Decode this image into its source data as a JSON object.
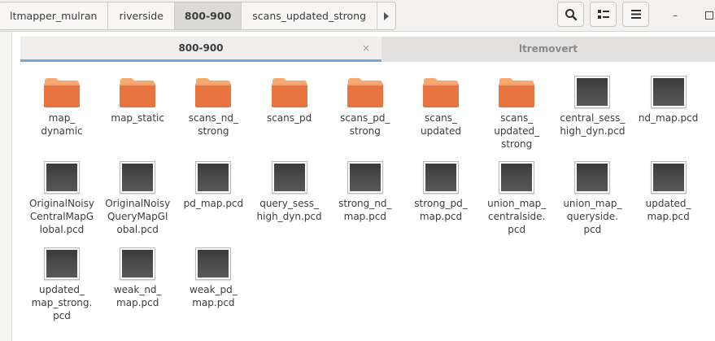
{
  "breadcrumbs": [
    "ltmapper_mulran",
    "riverside",
    "800-900",
    "scans_updated_strong"
  ],
  "active_crumb": "800-900",
  "toolbar": {
    "search_icon": "search-icon",
    "view_icon": "view-toggle-icon",
    "menu_icon": "hamburger-menu-icon"
  },
  "window": {
    "minimize": "–"
  },
  "tabs": [
    {
      "label": "800-900",
      "active": true,
      "close": "×"
    },
    {
      "label": "ltremovert",
      "active": false
    }
  ],
  "items": [
    {
      "name": "map_\ndynamic",
      "type": "folder"
    },
    {
      "name": "map_static",
      "type": "folder"
    },
    {
      "name": "scans_nd_\nstrong",
      "type": "folder"
    },
    {
      "name": "scans_pd",
      "type": "folder"
    },
    {
      "name": "scans_pd_\nstrong",
      "type": "folder"
    },
    {
      "name": "scans_\nupdated",
      "type": "folder"
    },
    {
      "name": "scans_\nupdated_\nstrong",
      "type": "folder"
    },
    {
      "name": "central_sess_\nhigh_dyn.pcd",
      "type": "file"
    },
    {
      "name": "nd_map.pcd",
      "type": "file"
    },
    {
      "name": "OriginalNoisy\nCentralMapG\nlobal.pcd",
      "type": "file"
    },
    {
      "name": "OriginalNoisy\nQueryMapGl\nobal.pcd",
      "type": "file"
    },
    {
      "name": "pd_map.pcd",
      "type": "file"
    },
    {
      "name": "query_sess_\nhigh_dyn.pcd",
      "type": "file"
    },
    {
      "name": "strong_nd_\nmap.pcd",
      "type": "file"
    },
    {
      "name": "strong_pd_\nmap.pcd",
      "type": "file"
    },
    {
      "name": "union_map_\ncentralside.\npcd",
      "type": "file"
    },
    {
      "name": "union_map_\nqueryside.\npcd",
      "type": "file"
    },
    {
      "name": "updated_\nmap.pcd",
      "type": "file"
    },
    {
      "name": "updated_\nmap_strong.\npcd",
      "type": "file"
    },
    {
      "name": "weak_nd_\nmap.pcd",
      "type": "file"
    },
    {
      "name": "weak_pd_\nmap.pcd",
      "type": "file"
    }
  ],
  "colors": {
    "folder_top": "#f6a870",
    "folder_body": "#e8743f",
    "tab_accent": "#6fa8dc"
  }
}
